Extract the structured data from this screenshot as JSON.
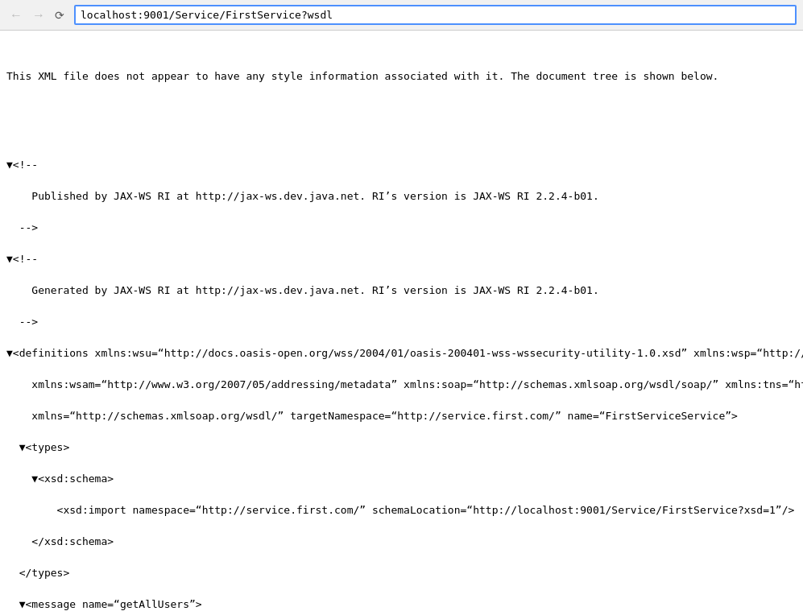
{
  "browser": {
    "url": "localhost:9001/Service/FirstService?wsdl",
    "back_disabled": true,
    "forward_disabled": true
  },
  "info_message": "This XML file does not appear to have any style information associated with it. The document tree is shown below.",
  "xml": {
    "comment1_line1": "<!--",
    "comment1_line2": "    Published by JAX-WS RI at http://jax-ws.dev.java.net. RI’s version is JAX-WS RI 2.2.4-b01.",
    "comment1_line3": "-->",
    "comment2_line1": "<!--",
    "comment2_line2": "    Generated by JAX-WS RI at http://jax-ws.dev.java.net. RI’s version is JAX-WS RI 2.2.4-b01.",
    "comment2_line3": "-->"
  },
  "nav": {
    "back": "←",
    "forward": "→",
    "reload": "↻"
  }
}
